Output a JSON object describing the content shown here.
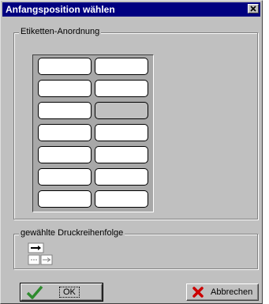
{
  "window": {
    "title": "Anfangsposition wählen"
  },
  "group_arrangement": {
    "label": "Etiketten-Anordnung",
    "rows": 7,
    "columns": 2,
    "selected": {
      "row": 3,
      "column": 2
    }
  },
  "group_order": {
    "label": "gewählte Druckreihenfolge"
  },
  "buttons": {
    "ok": "OK",
    "cancel": "Abbrechen"
  },
  "colors": {
    "titlebar": "#000080",
    "dialog": "#c0c0c0",
    "ok_check": "#2e8b2e",
    "cancel_x": "#cc0000"
  }
}
